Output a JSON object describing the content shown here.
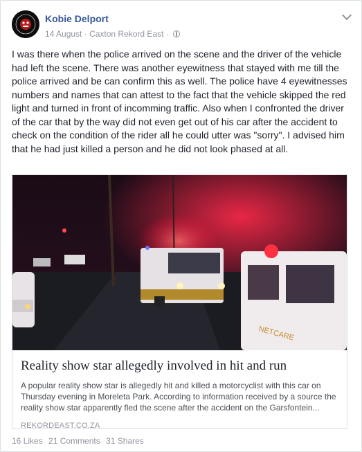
{
  "post": {
    "author": "Kobie Delport",
    "date": "14 August",
    "separator": " · ",
    "location": "Caxton Rekord East",
    "privacy_icon": "globe-icon",
    "avatar_text_top": "BIKERS MC",
    "avatar_text_bottom": "LIVE TO RIDE",
    "text": "I was there when the police arrived on the scene and the driver of the vehicle had left the scene. There was another eyewitness that stayed with me till the police arrived and be can confirm this as well. The police have 4 eyewitnesses numbers and names that can attest to the fact that the vehicle skipped the red light and turned in front of incomming traffic. Also when I confronted the driver of the car that by the way did not even get out of his car after the accident to check on the condition of the rider all he could utter was \"sorry\". I advised him that he had just killed a person and he did not look phased at all."
  },
  "link": {
    "image_text": "NETCARE",
    "title": "Reality show star allegedly involved in hit and run",
    "description": "A popular reality show star is allegedly hit and killed a motorcyclist with this car on Thursday evening in Moreleta Park. According to information received by a source the reality show star apparently fled the scene after the accident on the Garsfontein...",
    "domain": "REKORDEAST.CO.ZA"
  },
  "stats": {
    "likes": "16 Likes",
    "comments": "21 Comments",
    "shares": "31 Shares"
  },
  "colors": {
    "author_link": "#365899",
    "text": "#1d2129",
    "meta": "#90949c"
  }
}
